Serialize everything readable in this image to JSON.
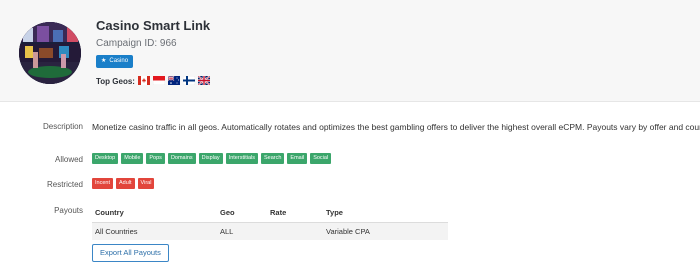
{
  "campaign": {
    "title": "Casino Smart Link",
    "campaign_id": "Campaign ID: 966",
    "category_badge": "Casino",
    "category_icon": "star-icon",
    "top_geos_label": "Top Geos:",
    "flags": [
      {
        "name": "canada-flag-icon",
        "label": "Canada"
      },
      {
        "name": "indonesia-flag-icon",
        "label": "Indonesia"
      },
      {
        "name": "australia-flag-icon",
        "label": "Australia"
      },
      {
        "name": "finland-flag-icon",
        "label": "Finland"
      },
      {
        "name": "uk-flag-icon",
        "label": "United Kingdom"
      }
    ]
  },
  "details": {
    "description_label": "Description",
    "description_text": "Monetize casino traffic in all geos. Automatically rotates and optimizes the best gambling offers to deliver the highest overall eCPM. Payouts vary by offer and country.",
    "allowed_label": "Allowed",
    "allowed_tags": [
      "Desktop",
      "Mobile",
      "Pops",
      "Domains",
      "Display",
      "Interstitials",
      "Search",
      "Email",
      "Social"
    ],
    "restricted_label": "Restricted",
    "restricted_tags": [
      "Incent",
      "Adult",
      "Viral"
    ],
    "payouts_label": "Payouts"
  },
  "payouts_table": {
    "headers": [
      "Country",
      "Geo",
      "Rate",
      "Type"
    ],
    "rows": [
      [
        "All Countries",
        "ALL",
        "",
        "Variable CPA"
      ]
    ]
  },
  "actions": {
    "export_label": "Export All Payouts"
  },
  "colors": {
    "allowed_tag": "#3ba66b",
    "restricted_tag": "#e2453b",
    "category_badge": "#1a7fc9"
  }
}
